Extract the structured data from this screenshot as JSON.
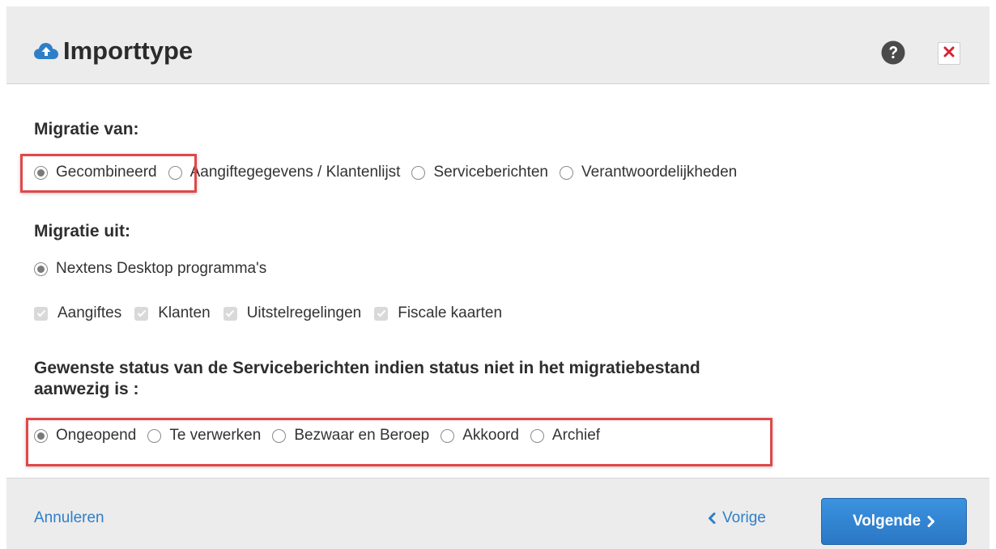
{
  "dialog": {
    "title": "Importtype",
    "title_icon": "cloud-upload-icon",
    "help_icon": "question-circle-icon",
    "close_icon": "close-x-icon"
  },
  "migratie_van": {
    "label": "Migratie van:",
    "options": [
      {
        "label": "Gecombineerd",
        "checked": true
      },
      {
        "label": "Aangiftegegevens / Klantenlijst",
        "checked": false
      },
      {
        "label": "Serviceberichten",
        "checked": false
      },
      {
        "label": "Verantwoordelijkheden",
        "checked": false
      }
    ]
  },
  "migratie_uit": {
    "label": "Migratie uit:",
    "source_option": {
      "label": "Nextens Desktop programma's",
      "checked": true
    },
    "checkboxes": [
      {
        "label": "Aangiftes",
        "checked": true,
        "disabled": true
      },
      {
        "label": "Klanten",
        "checked": true,
        "disabled": true
      },
      {
        "label": "Uitstelregelingen",
        "checked": true,
        "disabled": true
      },
      {
        "label": "Fiscale kaarten",
        "checked": true,
        "disabled": true
      }
    ]
  },
  "gewenste_status": {
    "label_line1": "Gewenste status van de Serviceberichten indien status niet in het migratiebestand",
    "label_line2": "aanwezig is :",
    "options": [
      {
        "label": "Ongeopend",
        "checked": true
      },
      {
        "label": "Te verwerken",
        "checked": false
      },
      {
        "label": "Bezwaar en Beroep",
        "checked": false
      },
      {
        "label": "Akkoord",
        "checked": false
      },
      {
        "label": "Archief",
        "checked": false
      }
    ]
  },
  "footer": {
    "cancel_label": "Annuleren",
    "prev_label": "Vorige",
    "next_label": "Volgende"
  },
  "colors": {
    "accent": "#2f7fc8",
    "highlight": "#e04848",
    "close": "#d9232f",
    "header_bg": "#ececec"
  }
}
